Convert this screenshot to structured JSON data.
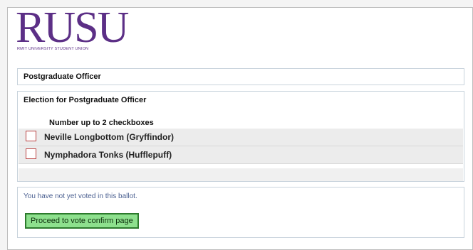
{
  "branding": {
    "logo_word": "RUSU",
    "logo_subtitle": "RMIT UNIVERSITY STUDENT UNION",
    "brand_color": "#5c2f86"
  },
  "ballot": {
    "position_title": "Postgraduate Officer",
    "election_heading": "Election for Postgraduate Officer",
    "instruction": "Number up to 2 checkboxes",
    "candidates": [
      {
        "name": "Neville Longbottom (Gryffindor)",
        "checked": false
      },
      {
        "name": "Nymphadora Tonks (Hufflepuff)",
        "checked": false
      }
    ]
  },
  "status": {
    "message": "You have not yet voted in this ballot.",
    "proceed_label": "Proceed to vote confirm page",
    "button_color": "#8de08d"
  }
}
